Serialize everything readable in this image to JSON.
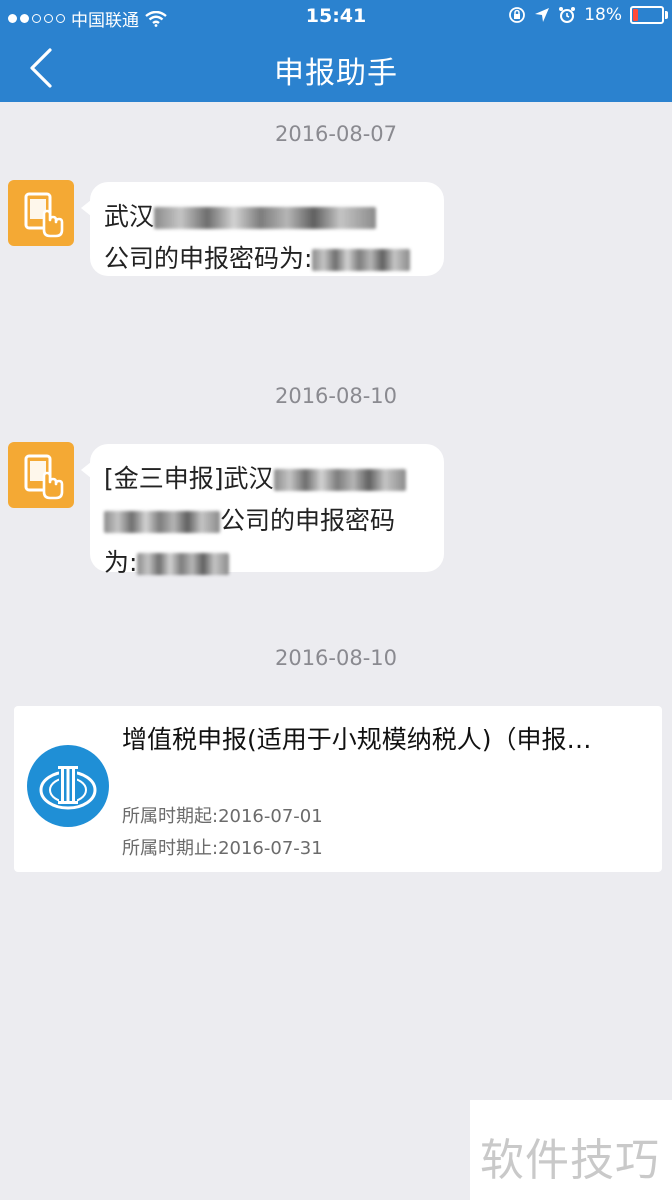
{
  "status_bar": {
    "carrier": "中国联通",
    "time": "15:41",
    "battery": "18%",
    "battery_level": 0.18
  },
  "nav": {
    "title": "申报助手"
  },
  "messages": [
    {
      "date": "2016-08-07",
      "line1": "武汉",
      "line2": "公司的申报密码为:"
    },
    {
      "date": "2016-08-10",
      "line1": "[金三申报]武汉",
      "line2": "公司的申报密码",
      "line3": "为:"
    }
  ],
  "card": {
    "date": "2016-08-10",
    "title": "增值税申报(适用于小规模纳税人)（申报…",
    "period_start": "所属时期起:2016-07-01",
    "period_end": "所属时期止:2016-07-31"
  },
  "watermark": "软件技巧",
  "colors": {
    "header": "#2b82cf",
    "avatar": "#f4a934",
    "logo": "#1f8fd6",
    "background": "#ececf0"
  }
}
